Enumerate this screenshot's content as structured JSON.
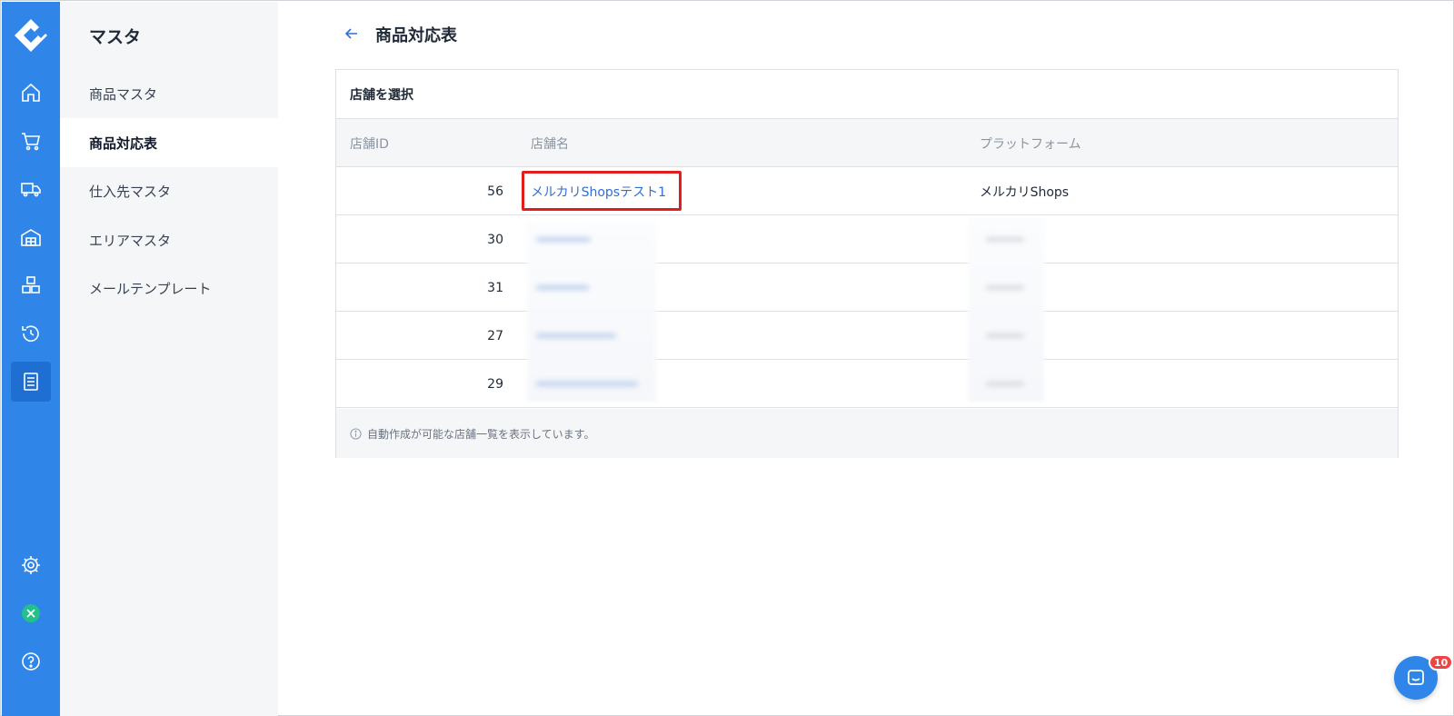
{
  "section_title": "マスタ",
  "sidebar": {
    "items": [
      {
        "label": "商品マスタ"
      },
      {
        "label": "商品対応表"
      },
      {
        "label": "仕入先マスタ"
      },
      {
        "label": "エリアマスタ"
      },
      {
        "label": "メールテンプレート"
      }
    ]
  },
  "rail_icons": [
    "home-icon",
    "cart-icon",
    "truck-icon",
    "warehouse-icon",
    "boxes-icon",
    "history-icon",
    "list-icon",
    "settings-icon",
    "status-icon",
    "help-icon"
  ],
  "page": {
    "title": "商品対応表"
  },
  "card": {
    "header": "店舗を選択",
    "columns": {
      "id": "店舗ID",
      "name": "店舗名",
      "platform": "プラットフォーム"
    },
    "rows": [
      {
        "id": "56",
        "name": "メルカリShopsテスト1",
        "platform": "メルカリShops"
      },
      {
        "id": "30",
        "name": "",
        "platform": ""
      },
      {
        "id": "31",
        "name": "",
        "platform": ""
      },
      {
        "id": "27",
        "name": "",
        "platform": ""
      },
      {
        "id": "29",
        "name": "",
        "platform": ""
      }
    ],
    "footer": "自動作成が可能な店舗一覧を表示しています。"
  },
  "chat": {
    "badge": "10"
  },
  "colors": {
    "accent": "#2f86e8",
    "highlight": "#e11d1d",
    "link": "#2f6fd6"
  }
}
